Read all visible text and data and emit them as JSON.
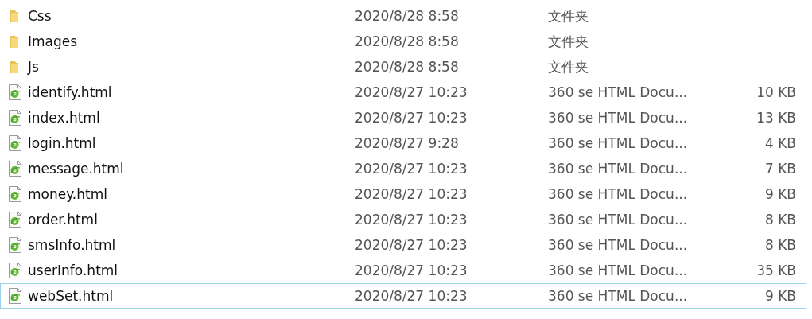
{
  "files": [
    {
      "kind": "folder",
      "name": "Css",
      "modified": "2020/8/28 8:58",
      "type": "文件夹",
      "focused": false
    },
    {
      "kind": "folder",
      "name": "Images",
      "modified": "2020/8/28 8:58",
      "type": "文件夹",
      "focused": false
    },
    {
      "kind": "folder",
      "name": "Js",
      "modified": "2020/8/28 8:58",
      "type": "文件夹",
      "focused": false
    },
    {
      "kind": "html",
      "name": "identify.html",
      "modified": "2020/8/27 10:23",
      "type": "360 se HTML Docu...",
      "size": "10 KB",
      "focused": false
    },
    {
      "kind": "html",
      "name": "index.html",
      "modified": "2020/8/27 10:23",
      "type": "360 se HTML Docu...",
      "size": "13 KB",
      "focused": false
    },
    {
      "kind": "html",
      "name": "login.html",
      "modified": "2020/8/27 9:28",
      "type": "360 se HTML Docu...",
      "size": "4 KB",
      "focused": false
    },
    {
      "kind": "html",
      "name": "message.html",
      "modified": "2020/8/27 10:23",
      "type": "360 se HTML Docu...",
      "size": "7 KB",
      "focused": false
    },
    {
      "kind": "html",
      "name": "money.html",
      "modified": "2020/8/27 10:23",
      "type": "360 se HTML Docu...",
      "size": "9 KB",
      "focused": false
    },
    {
      "kind": "html",
      "name": "order.html",
      "modified": "2020/8/27 10:23",
      "type": "360 se HTML Docu...",
      "size": "8 KB",
      "focused": false
    },
    {
      "kind": "html",
      "name": "smsInfo.html",
      "modified": "2020/8/27 10:23",
      "type": "360 se HTML Docu...",
      "size": "8 KB",
      "focused": false
    },
    {
      "kind": "html",
      "name": "userInfo.html",
      "modified": "2020/8/27 10:23",
      "type": "360 se HTML Docu...",
      "size": "35 KB",
      "focused": false
    },
    {
      "kind": "html",
      "name": "webSet.html",
      "modified": "2020/8/27 10:23",
      "type": "360 se HTML Docu...",
      "size": "9 KB",
      "focused": true
    }
  ]
}
